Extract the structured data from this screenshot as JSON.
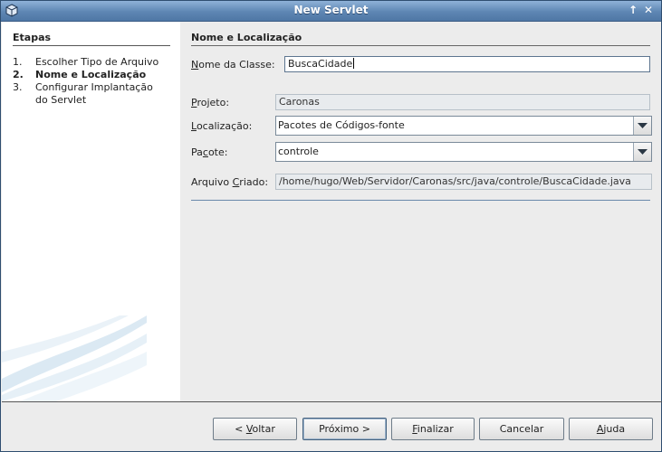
{
  "window": {
    "title": "New Servlet",
    "minimize_glyph": "↑",
    "close_glyph": "✕"
  },
  "steps_panel": {
    "heading": "Etapas",
    "steps": [
      {
        "num": "1.",
        "label": "Escolher Tipo de Arquivo",
        "current": false
      },
      {
        "num": "2.",
        "label": "Nome e Localização",
        "current": true
      },
      {
        "num": "3.",
        "label": "Configurar Implantação",
        "label2": "do Servlet",
        "current": false
      }
    ]
  },
  "form": {
    "heading": "Nome e Localização",
    "class_name": {
      "label_mnemonic": "N",
      "label_rest": "ome da Classe:",
      "value": "BuscaCidade"
    },
    "project": {
      "label_mnemonic": "P",
      "label_rest": "rojeto:",
      "value": "Caronas"
    },
    "location": {
      "label_mnemonic": "L",
      "label_rest": "ocalização:",
      "value": "Pacotes de Códigos-fonte"
    },
    "package": {
      "label_pre": "Pa",
      "label_mnemonic": "c",
      "label_rest": "ote:",
      "value": "controle"
    },
    "created_file": {
      "label_pre": "Arquivo ",
      "label_mnemonic": "C",
      "label_rest": "riado:",
      "value": "/home/hugo/Web/Servidor/Caronas/src/java/controle/BuscaCidade.java"
    }
  },
  "buttons": {
    "back": {
      "pre": "< ",
      "mnemonic": "V",
      "rest": "oltar"
    },
    "next": {
      "label": "Próximo >"
    },
    "finish": {
      "mnemonic": "F",
      "rest": "inalizar"
    },
    "cancel": {
      "label": "Cancelar"
    },
    "help": {
      "mnemonic": "A",
      "rest": "juda"
    }
  },
  "colors": {
    "title_bar": "#5e86b3",
    "accent_line": "#6a89ab"
  }
}
